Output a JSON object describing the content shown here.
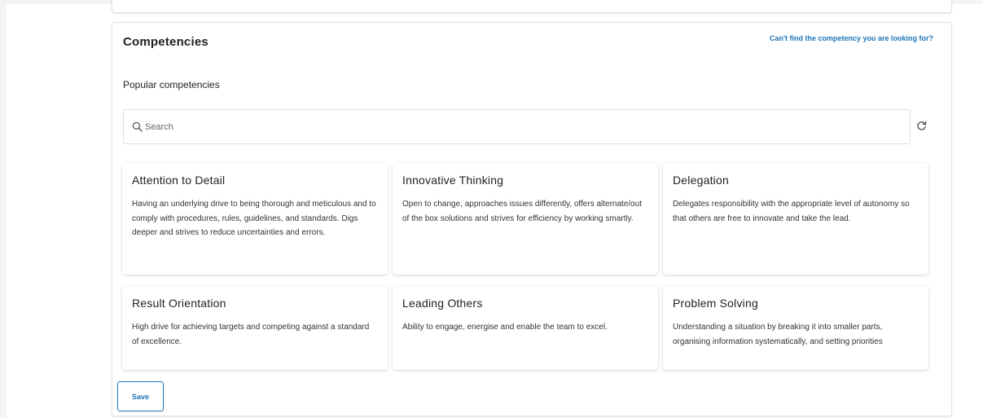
{
  "section": {
    "title": "Competencies",
    "help_link": "Can't find the competency you are looking for?",
    "subtitle": "Popular competencies"
  },
  "search": {
    "placeholder": "Search",
    "value": ""
  },
  "competencies": [
    {
      "title": "Attention to Detail",
      "description": "Having an underlying drive to being thorough and meticulous and to comply with procedures, rules, guidelines, and standards. Digs deeper and strives to reduce uncertainties and errors."
    },
    {
      "title": "Innovative Thinking",
      "description": "Open to change, approaches issues differently, offers alternate/out of the box solutions and strives for efficiency by working smartly."
    },
    {
      "title": "Delegation",
      "description": "Delegates responsibility with the appropriate level of autonomy so that others are free to innovate and take the lead."
    },
    {
      "title": "Result Orientation",
      "description": "High drive for achieving targets and competing against a standard of excellence."
    },
    {
      "title": "Leading Others",
      "description": "Ability to engage, energise and enable the team to excel."
    },
    {
      "title": "Problem Solving",
      "description": "Understanding a situation by breaking it into smaller parts, organising information systematically, and setting priorities"
    }
  ],
  "actions": {
    "save_label": "Save"
  },
  "icons": {
    "search": "search-icon",
    "refresh": "refresh-icon"
  },
  "colors": {
    "accent": "#1c75b9",
    "text": "#222222",
    "border": "#dedede"
  }
}
